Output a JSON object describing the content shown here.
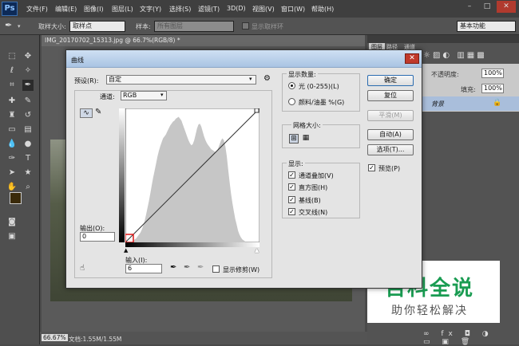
{
  "app": {
    "logo": "Ps",
    "menus": [
      "文件(F)",
      "编辑(E)",
      "图像(I)",
      "图层(L)",
      "文字(Y)",
      "选择(S)",
      "滤镜(T)",
      "3D(D)",
      "视图(V)",
      "窗口(W)",
      "帮助(H)"
    ],
    "win_controls": [
      "–",
      "□",
      "✕"
    ]
  },
  "options": {
    "size_label": "取样大小:",
    "size_value": "取样点",
    "sample_label": "样本:",
    "sample_value": "所有图层",
    "show_ring": "显示取样环",
    "workspace": "基本功能"
  },
  "document": {
    "tab": "IMG_20170702_15313.jpg @ 66.7%(RGB/8) *",
    "zoom": "66.67%",
    "info": "文档:1.55M/1.55M"
  },
  "right_panel": {
    "tabs": [
      "图层",
      "路径",
      "通道"
    ],
    "opacity_label": "不透明度:",
    "opacity": "100%",
    "fill_label": "填充:",
    "fill": "100%",
    "layer_name": "背景"
  },
  "dialog": {
    "title": "曲线",
    "preset_label": "预设(R):",
    "preset_value": "自定",
    "channel_label": "通道:",
    "channel_value": "RGB",
    "output_label": "输出(O):",
    "output_value": "0",
    "input_label": "输入(I):",
    "input_value": "6",
    "show_clip": "显示修剪(W)",
    "display_amount": {
      "title": "显示数量:",
      "light": "光 (0-255)(L)",
      "pigment": "颜料/油墨 %(G)"
    },
    "grid_size": {
      "title": "网格大小:"
    },
    "display": {
      "title": "显示:",
      "channel_overlay": "通道叠加(V)",
      "histogram": "直方图(H)",
      "baseline": "基线(B)",
      "intersection": "交叉线(N)"
    },
    "buttons": {
      "ok": "确定",
      "reset": "复位",
      "smooth": "平滑(M)",
      "auto": "自动(A)",
      "options": "选项(T)...",
      "preview": "预览(P)"
    }
  },
  "watermark": {
    "title": "百科全说",
    "subtitle": "助你轻松解决"
  },
  "curve": {
    "histogram": [
      2,
      3,
      4,
      6,
      8,
      10,
      13,
      17,
      22,
      28,
      35,
      42,
      50,
      58,
      66,
      73,
      80,
      87,
      93,
      98,
      102,
      106,
      108,
      110,
      113,
      116,
      119,
      121,
      123,
      124,
      126,
      127,
      128,
      126,
      124,
      120,
      116,
      112,
      108,
      104,
      101,
      99,
      100,
      104,
      110,
      116,
      120,
      121,
      118,
      113,
      108,
      104,
      101,
      99,
      97,
      95,
      94,
      93,
      92,
      93,
      96,
      100,
      104,
      106,
      104,
      98,
      88,
      75,
      62,
      50,
      40,
      32,
      24,
      18,
      12,
      8,
      5,
      3,
      2,
      1
    ]
  }
}
